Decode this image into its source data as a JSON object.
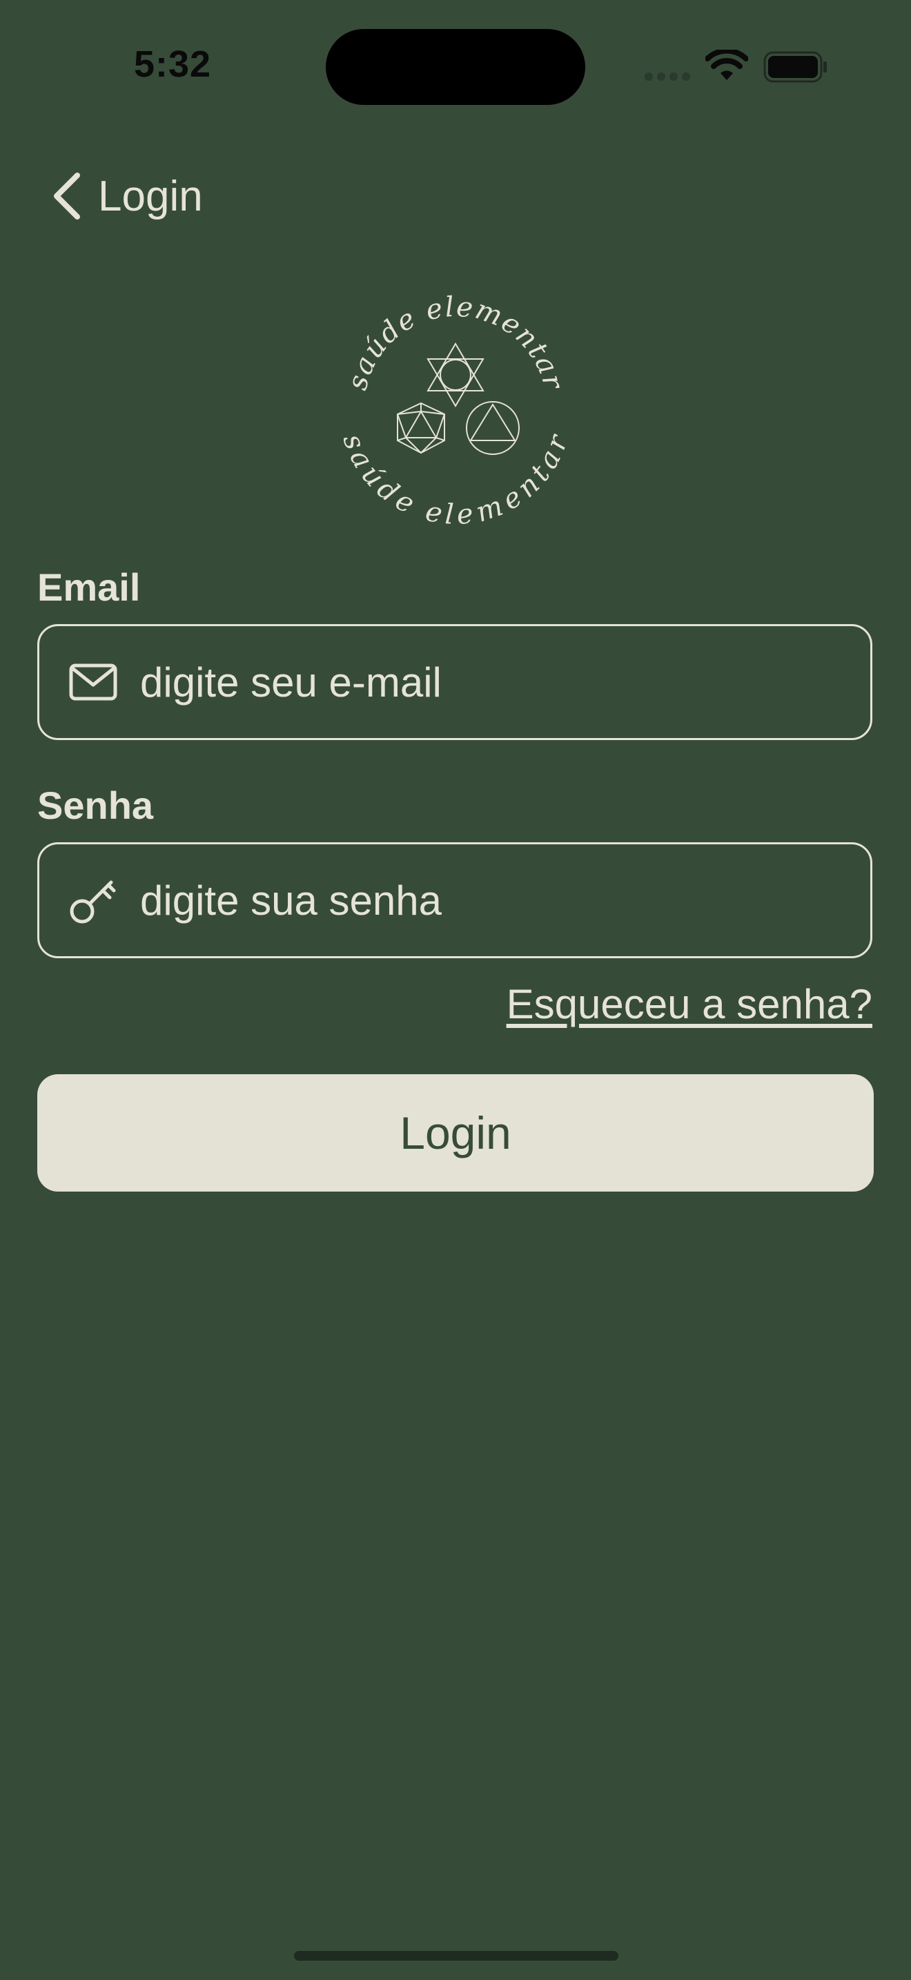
{
  "status_bar": {
    "time": "5:32"
  },
  "nav": {
    "back_label": "Login"
  },
  "logo": {
    "top_text": "saúde elementar",
    "bottom_text": "saúde elementar"
  },
  "form": {
    "email_label": "Email",
    "email_placeholder": "digite seu e-mail",
    "email_value": "",
    "password_label": "Senha",
    "password_placeholder": "digite sua senha",
    "password_value": "",
    "forgot_password": "Esqueceu a senha?",
    "login_button": "Login"
  },
  "icons": {
    "back": "chevron-left-icon",
    "email": "envelope-icon",
    "password": "key-icon"
  },
  "colors": {
    "background": "#374b39",
    "foreground": "#e5e4d6",
    "button_bg": "#e3e2d4",
    "button_text": "#374b39"
  }
}
